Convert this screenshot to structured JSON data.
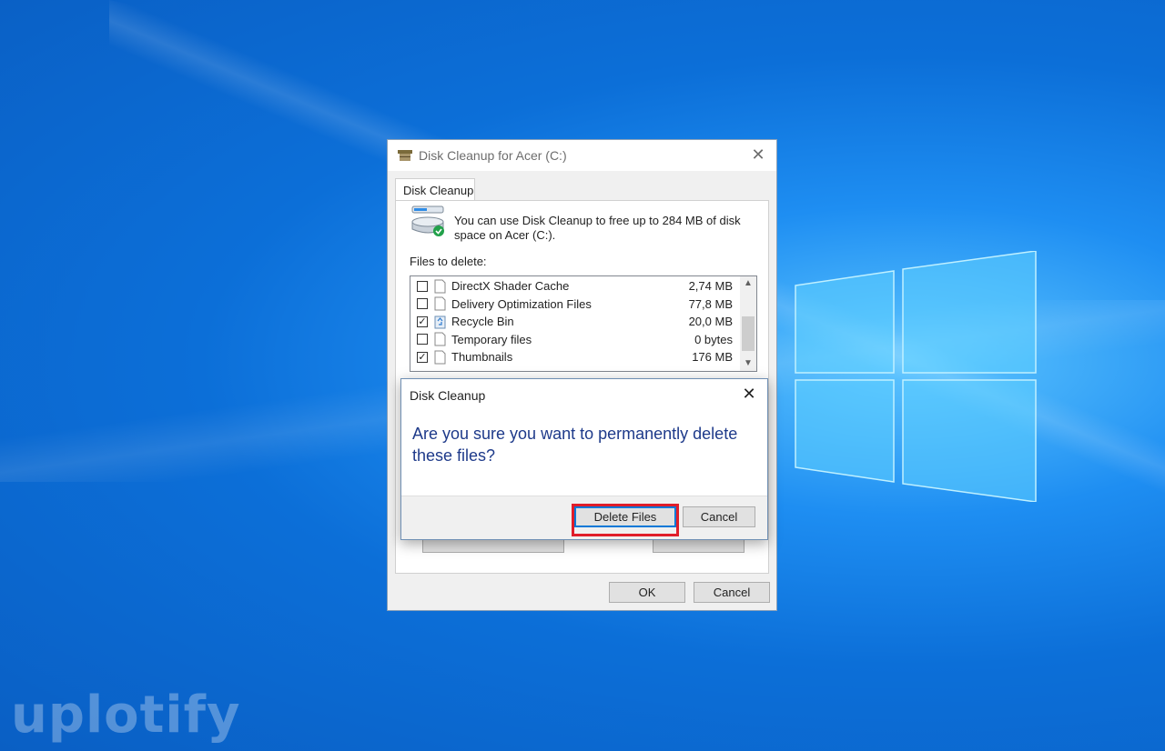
{
  "desktop": {
    "watermark": "uplotify"
  },
  "main_dialog": {
    "title": "Disk Cleanup for Acer (C:)",
    "close_glyph": "✕",
    "tab_label": "Disk Cleanup",
    "description": "You can use Disk Cleanup to free up to 284 MB of disk space on Acer (C:).",
    "files_label": "Files to delete:",
    "files": [
      {
        "name": "DirectX Shader Cache",
        "size": "2,74 MB",
        "checked": false,
        "icon": "file-icon"
      },
      {
        "name": "Delivery Optimization Files",
        "size": "77,8 MB",
        "checked": false,
        "icon": "file-icon"
      },
      {
        "name": "Recycle Bin",
        "size": "20,0 MB",
        "checked": true,
        "icon": "recycle-bin-icon"
      },
      {
        "name": "Temporary files",
        "size": "0 bytes",
        "checked": false,
        "icon": "file-icon"
      },
      {
        "name": "Thumbnails",
        "size": "176 MB",
        "checked": true,
        "icon": "file-icon"
      }
    ],
    "ok_label": "OK",
    "cancel_label": "Cancel"
  },
  "confirm_dialog": {
    "title": "Disk Cleanup",
    "close_glyph": "✕",
    "message": "Are you sure you want to permanently delete these files?",
    "delete_label": "Delete Files",
    "cancel_label": "Cancel"
  },
  "colors": {
    "desktop_blue": "#0c6fd8",
    "message_blue": "#1e3a8a",
    "highlight_red": "#e01e2a",
    "focus_blue": "#0078d7"
  }
}
